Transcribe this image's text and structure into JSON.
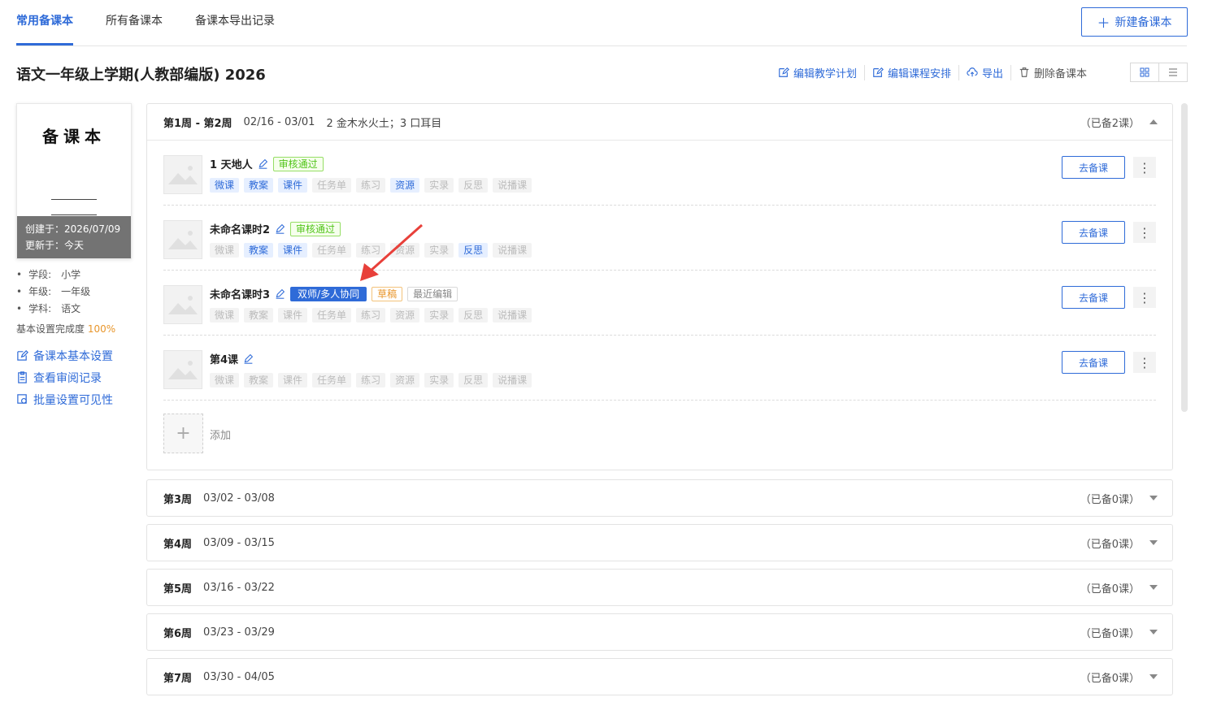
{
  "tabs": [
    {
      "label": "常用备课本"
    },
    {
      "label": "所有备课本"
    },
    {
      "label": "备课本导出记录"
    }
  ],
  "new_button": "新建备课本",
  "page_title": "语文一年级上学期(人教部编版) 2026",
  "actions": [
    {
      "label": "编辑教学计划"
    },
    {
      "label": "编辑课程安排"
    },
    {
      "label": "导出"
    },
    {
      "label": "删除备课本"
    }
  ],
  "cover": {
    "title": "备课本",
    "created": "创建于：2026/07/09",
    "updated": "更新于：今天"
  },
  "info": [
    {
      "label": "学段:",
      "value": "小学"
    },
    {
      "label": "年级:",
      "value": "一年级"
    },
    {
      "label": "学科:",
      "value": "语文"
    }
  ],
  "progress": {
    "label": "基本设置完成度",
    "value": "100%"
  },
  "side_links": [
    {
      "label": "备课本基本设置"
    },
    {
      "label": "查看审阅记录"
    },
    {
      "label": "批量设置可见性"
    }
  ],
  "weeks": [
    {
      "name": "第1周 - 第2周",
      "range": "02/16 - 03/01",
      "lessons": "2 金木水火土；3 口耳目",
      "count": "（已备2课）",
      "expanded": true
    },
    {
      "name": "第3周",
      "range": "03/02 - 03/08",
      "count": "（已备0课）"
    },
    {
      "name": "第4周",
      "range": "03/09 - 03/15",
      "count": "（已备0课）"
    },
    {
      "name": "第5周",
      "range": "03/16 - 03/22",
      "count": "（已备0课）"
    },
    {
      "name": "第6周",
      "range": "03/23 - 03/29",
      "count": "（已备0课）"
    },
    {
      "name": "第7周",
      "range": "03/30 - 04/05",
      "count": "（已备0课）"
    }
  ],
  "lessons": [
    {
      "name": "1 天地人",
      "badges": [
        "审核通过"
      ],
      "active_tags": [
        0,
        1,
        2,
        5
      ]
    },
    {
      "name": "未命名课时2",
      "badges": [
        "审核通过"
      ],
      "active_tags": [
        1,
        2,
        7
      ]
    },
    {
      "name": "未命名课时3",
      "badges": [
        "双师/多人协同",
        "草稿",
        "最近编辑"
      ],
      "active_tags": []
    },
    {
      "name": "第4课",
      "badges": [],
      "active_tags": []
    }
  ],
  "tag_labels": [
    "微课",
    "教案",
    "课件",
    "任务单",
    "练习",
    "资源",
    "实录",
    "反思",
    "说播课"
  ],
  "go_button": "去备课",
  "more_button": "⋮",
  "add_label": "添加",
  "colors": {
    "accent": "#2f6bd8",
    "success": "#52c41a",
    "warning": "#e8962c",
    "arrow": "#e8403a"
  }
}
